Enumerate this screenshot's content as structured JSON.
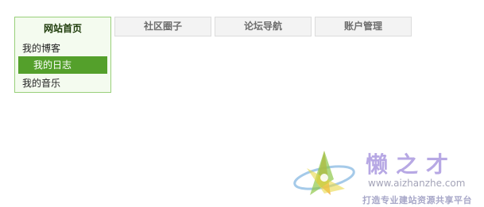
{
  "nav": {
    "active_tab": "网站首页",
    "tabs": [
      "社区圈子",
      "论坛导航",
      "账户管理"
    ],
    "dropdown_items": [
      "我的博客",
      "我的日志",
      "我的音乐"
    ],
    "selected_item": "我的日志"
  },
  "watermark": {
    "title": "懒之才",
    "url": "www.aizhanzhe.com",
    "slogan": "打造专业建站资源共享平台"
  },
  "colors": {
    "active_border": "#99d07a",
    "active_bg": "#f4fbef",
    "selected_bg": "#54a02b",
    "tab_bg": "#f3f3f3",
    "tab_border": "#dcdcdc",
    "watermark_text": "#b7a8e4"
  }
}
